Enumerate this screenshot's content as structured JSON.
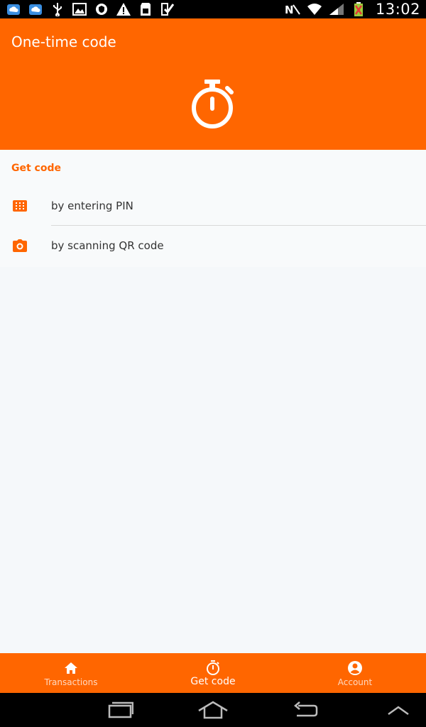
{
  "status_bar": {
    "time": "13:02",
    "left_icons": [
      "cloud-icon",
      "cloud-icon",
      "usb-icon",
      "image-icon",
      "shield-icon",
      "warning-icon",
      "sd-card-icon",
      "checklist-icon"
    ],
    "right_icons": [
      "nfc-icon",
      "wifi-icon",
      "signal-icon",
      "battery-icon"
    ]
  },
  "header": {
    "title": "One-time code",
    "hero_icon": "stopwatch-icon"
  },
  "section": {
    "title": "Get code",
    "items": [
      {
        "label": "by entering PIN",
        "icon": "keypad-icon"
      },
      {
        "label": "by scanning QR code",
        "icon": "camera-icon"
      }
    ]
  },
  "bottom_nav": {
    "items": [
      {
        "label": "Transactions",
        "icon": "home-icon",
        "active": false
      },
      {
        "label": "Get code",
        "icon": "stopwatch-icon",
        "active": true
      },
      {
        "label": "Account",
        "icon": "account-icon",
        "active": false
      }
    ]
  },
  "system_nav": {
    "buttons": [
      "recent-apps-icon",
      "home-icon",
      "back-icon",
      "chevron-up-icon"
    ]
  },
  "colors": {
    "accent": "#ff6600",
    "background": "#f5f8fa",
    "text": "#333333"
  }
}
